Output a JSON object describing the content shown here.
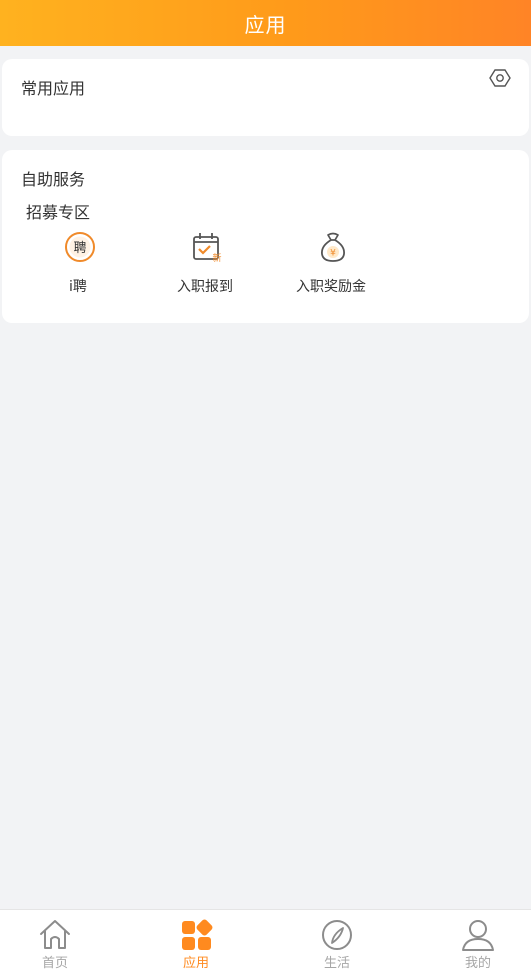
{
  "header": {
    "title": "应用"
  },
  "common_apps": {
    "title": "常用应用",
    "settings_icon": "settings-hexagon-icon"
  },
  "self_service": {
    "title": "自助服务",
    "section": "招募专区",
    "apps": [
      {
        "label": "i聘",
        "icon": "recruit-badge-icon",
        "icon_text": "聘"
      },
      {
        "label": "入职报到",
        "icon": "calendar-check-icon",
        "icon_text": "新"
      },
      {
        "label": "入职奖励金",
        "icon": "money-bag-icon",
        "icon_text": "¥"
      }
    ]
  },
  "bottom_nav": {
    "active_index": 1,
    "items": [
      {
        "label": "首页",
        "icon": "home-icon"
      },
      {
        "label": "应用",
        "icon": "apps-grid-icon"
      },
      {
        "label": "生活",
        "icon": "compass-icon"
      },
      {
        "label": "我的",
        "icon": "user-icon"
      }
    ]
  },
  "colors": {
    "header_gradient_start": "#ffb21f",
    "header_gradient_end": "#ff8426",
    "accent": "#ff8a1f",
    "inactive_nav": "#a6a6a6",
    "background": "#f2f3f5",
    "card": "#ffffff",
    "text_primary": "#333333"
  }
}
